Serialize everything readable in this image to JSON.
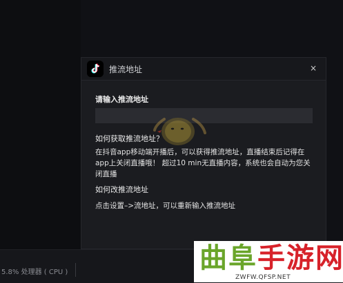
{
  "dialog": {
    "title": "推流地址",
    "close_label": "×",
    "url_label": "请输入推流地址",
    "url_value": "",
    "url_placeholder": "",
    "how_to_get_title": "如何获取推流地址？",
    "how_to_get_text": "在抖音app移动端开播后，可以获得推流地址，直播结束后记得在app上关闭直播哦！ 超过10 min无直播内容，系统也会自动为您关闭直播",
    "how_to_change_title": "如何改推流地址",
    "how_to_change_text": "点击设置–>流地址，可以重新输入推流地址"
  },
  "status_bar": {
    "cpu_text": "5.8% 处理器 ( CPU )"
  },
  "watermark": {
    "title_part1": "曲阜",
    "title_part2": "手游网",
    "url": "ZWFW.QFSP.NET"
  },
  "icons": {
    "logo": "tiktok-logo-icon",
    "close": "close-icon",
    "mascot": "mascot-watermark-icon"
  },
  "colors": {
    "dialog_bg": "#1b1c20",
    "header_bg": "#17181c",
    "input_bg": "#2b2c31",
    "watermark_green": "#6aa52a",
    "watermark_red": "#d7222a"
  }
}
